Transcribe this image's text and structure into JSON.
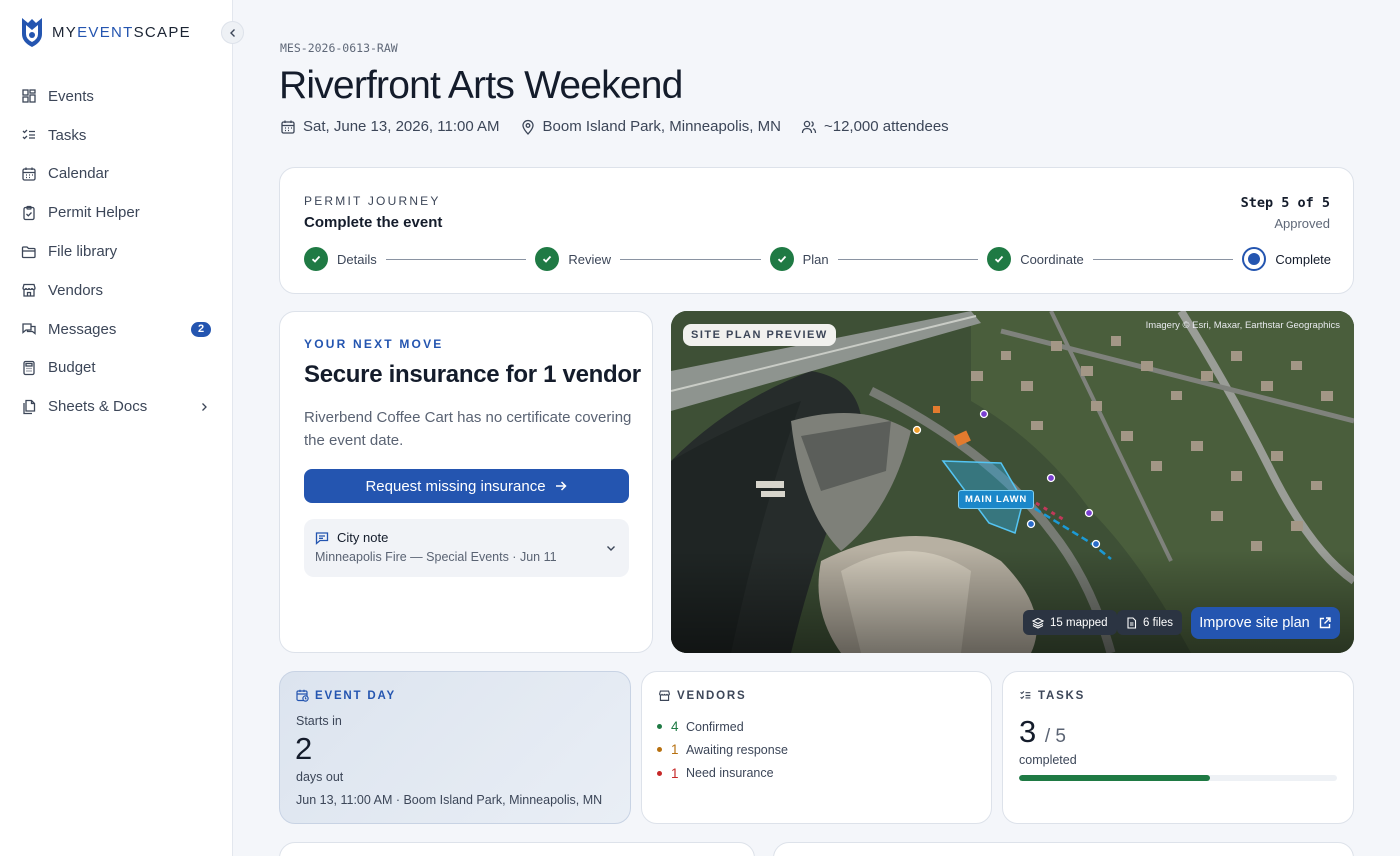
{
  "brand": {
    "name_a": "MY",
    "name_b": "EVENT",
    "name_c": "SCAPE",
    "icon": "shield-logo-icon"
  },
  "sidebar": {
    "items": [
      {
        "label": "Events",
        "icon": "grid-icon"
      },
      {
        "label": "Tasks",
        "icon": "checklist-icon"
      },
      {
        "label": "Calendar",
        "icon": "calendar-icon"
      },
      {
        "label": "Permit Helper",
        "icon": "clipboard-check-icon"
      },
      {
        "label": "File library",
        "icon": "folder-icon"
      },
      {
        "label": "Vendors",
        "icon": "store-icon"
      },
      {
        "label": "Messages",
        "icon": "chat-icon",
        "badge": "2"
      },
      {
        "label": "Budget",
        "icon": "calculator-icon"
      },
      {
        "label": "Sheets & Docs",
        "icon": "documents-icon"
      }
    ]
  },
  "event": {
    "code": "MES-2026-0613-RAW",
    "title": "Riverfront Arts Weekend",
    "date": "Sat, June 13, 2026, 11:00 AM",
    "location": "Boom Island Park, Minneapolis, MN",
    "attendees": "~12,000 attendees"
  },
  "journey": {
    "eyebrow": "PERMIT JOURNEY",
    "subtitle": "Complete the event",
    "step_text": "Step 5 of 5",
    "status": "Approved",
    "current_step": 5,
    "steps": [
      "Details",
      "Review",
      "Plan",
      "Coordinate",
      "Complete"
    ]
  },
  "next_move": {
    "eyebrow": "YOUR NEXT MOVE",
    "title": "Secure insurance for 1 vendor",
    "body": "Riverbend Coffee Cart has no certificate covering the event date.",
    "button": "Request missing insurance",
    "note_title": "City note",
    "note_sub": "Minneapolis Fire — Special Events · Jun 11"
  },
  "map": {
    "chip": "SITE PLAN PREVIEW",
    "attribution": "Imagery © Esri, Maxar, Earthstar Geographics",
    "area_label": "MAIN LAWN",
    "mapped": "15 mapped",
    "files": "6 files",
    "improve_button": "Improve site plan"
  },
  "event_day": {
    "heading": "EVENT DAY",
    "starts": "Starts in",
    "days": "2",
    "days_label": "days out",
    "when_where": "Jun 13, 11:00 AM · Boom Island Park, Minneapolis, MN"
  },
  "vendors": {
    "heading": "VENDORS",
    "rows": [
      {
        "count": "4",
        "label": "Confirmed",
        "color": "#1f7a44"
      },
      {
        "count": "1",
        "label": "Awaiting response",
        "color": "#b7700f"
      },
      {
        "count": "1",
        "label": "Need insurance",
        "color": "#c62828"
      }
    ]
  },
  "tasks": {
    "heading": "TASKS",
    "done": "3",
    "total": "/ 5",
    "label": "completed",
    "progress": 0.6
  },
  "colors": {
    "accent": "#2455b0",
    "success": "#1f7a44",
    "warning": "#b7700f",
    "danger": "#c62828"
  }
}
